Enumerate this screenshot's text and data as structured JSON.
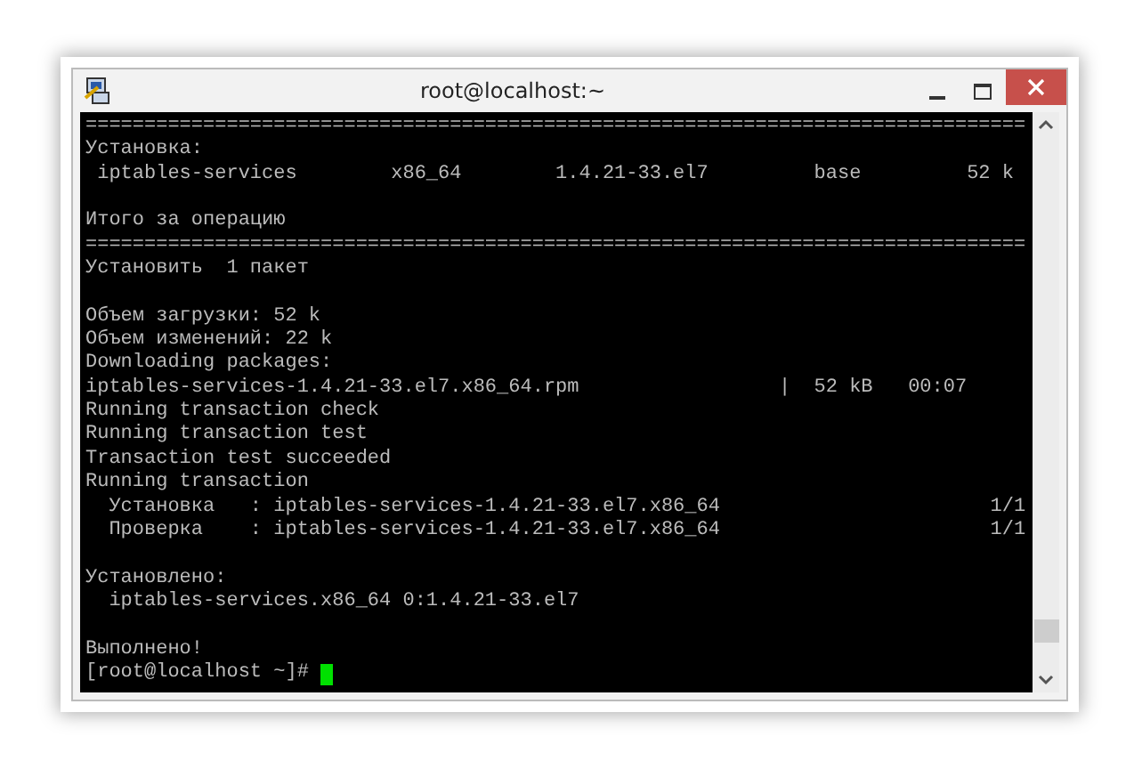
{
  "window": {
    "title": "root@localhost:~"
  },
  "terminal": {
    "lines": [
      {
        "kind": "text",
        "text": "================================================================================"
      },
      {
        "kind": "text",
        "text": "Установка:"
      },
      {
        "kind": "text",
        "text": " iptables-services        x86_64        1.4.21-33.el7         base         52 k"
      },
      {
        "kind": "blank"
      },
      {
        "kind": "text",
        "text": "Итого за операцию"
      },
      {
        "kind": "text",
        "text": "================================================================================"
      },
      {
        "kind": "text",
        "text": "Установить  1 пакет"
      },
      {
        "kind": "blank"
      },
      {
        "kind": "text",
        "text": "Объем загрузки: 52 k"
      },
      {
        "kind": "text",
        "text": "Объем изменений: 22 k"
      },
      {
        "kind": "text",
        "text": "Downloading packages:"
      },
      {
        "kind": "text",
        "text": "iptables-services-1.4.21-33.el7.x86_64.rpm                 |  52 kB   00:07"
      },
      {
        "kind": "text",
        "text": "Running transaction check"
      },
      {
        "kind": "text",
        "text": "Running transaction test"
      },
      {
        "kind": "text",
        "text": "Transaction test succeeded"
      },
      {
        "kind": "text",
        "text": "Running transaction"
      },
      {
        "kind": "text",
        "text": "  Установка   : iptables-services-1.4.21-33.el7.x86_64                       1/1"
      },
      {
        "kind": "text",
        "text": "  Проверка    : iptables-services-1.4.21-33.el7.x86_64                       1/1"
      },
      {
        "kind": "blank"
      },
      {
        "kind": "text",
        "text": "Установлено:"
      },
      {
        "kind": "text",
        "text": "  iptables-services.x86_64 0:1.4.21-33.el7"
      },
      {
        "kind": "blank"
      },
      {
        "kind": "text",
        "text": "Выполнено!"
      },
      {
        "kind": "prompt",
        "text": "[root@localhost ~]# ",
        "cursor": true
      }
    ]
  }
}
